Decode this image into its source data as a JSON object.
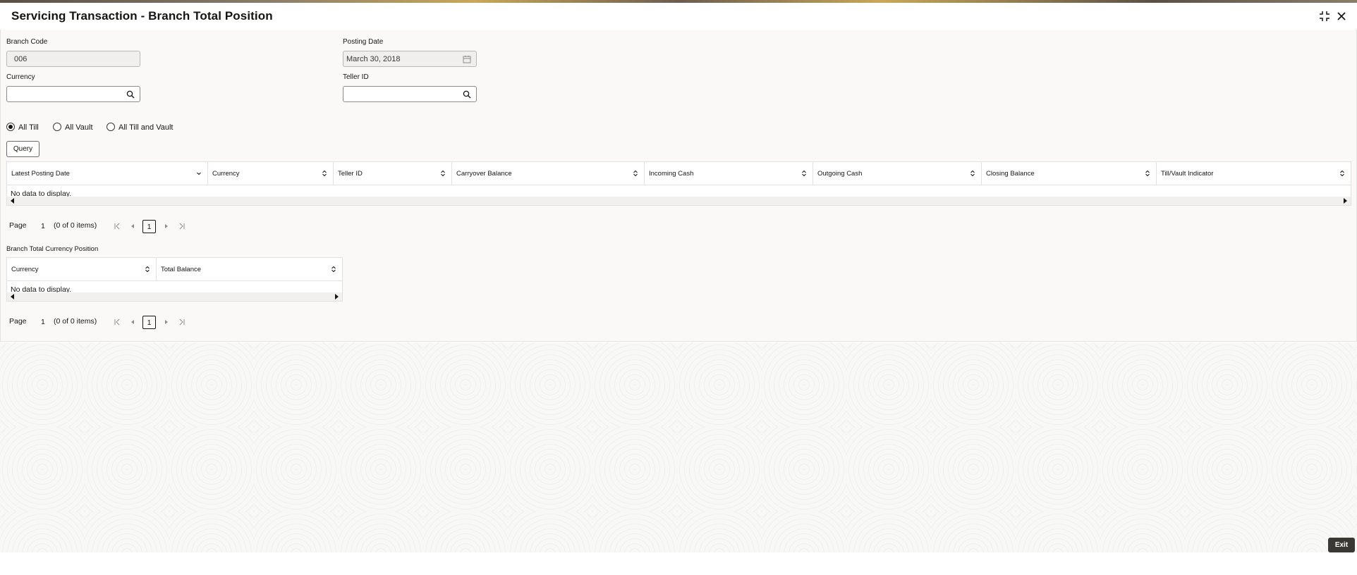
{
  "window": {
    "title": "Servicing Transaction - Branch Total Position"
  },
  "form": {
    "branch_code": {
      "label": "Branch Code",
      "value": "006"
    },
    "posting_date": {
      "label": "Posting Date",
      "value": "March 30, 2018"
    },
    "currency": {
      "label": "Currency",
      "value": "",
      "placeholder": ""
    },
    "teller_id": {
      "label": "Teller ID",
      "value": "",
      "placeholder": ""
    }
  },
  "filter": {
    "options": [
      {
        "label": "All Till",
        "selected": true
      },
      {
        "label": "All Vault",
        "selected": false
      },
      {
        "label": "All Till and Vault",
        "selected": false
      }
    ],
    "query_label": "Query"
  },
  "position_table": {
    "columns": [
      "Latest Posting Date",
      "Currency",
      "Teller ID",
      "Carryover Balance",
      "Incoming Cash",
      "Outgoing Cash",
      "Closing Balance",
      "Till/Vault Indicator"
    ],
    "empty_text": "No data to display.",
    "pager": {
      "page_label": "Page",
      "page": "1",
      "items": "(0 of 0 items)",
      "current": "1"
    }
  },
  "currency_section": {
    "title": "Branch Total Currency Position",
    "columns": [
      "Currency",
      "Total Balance"
    ],
    "empty_text": "No data to display.",
    "pager": {
      "page_label": "Page",
      "page": "1",
      "items": "(0 of 0 items)",
      "current": "1"
    }
  },
  "footer": {
    "exit_label": "Exit"
  },
  "icons": {
    "maximize": "collapse-icon",
    "close": "close-icon",
    "calendar": "calendar-icon",
    "search": "search-icon",
    "sort": "sort-icon"
  }
}
